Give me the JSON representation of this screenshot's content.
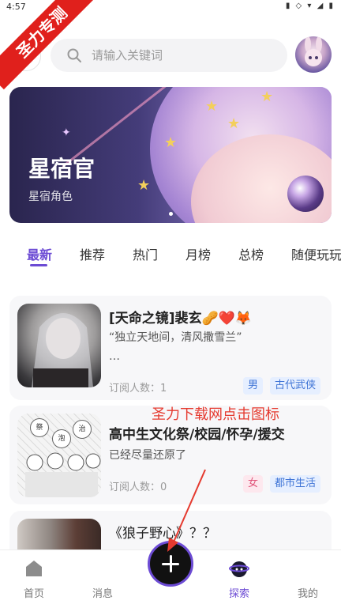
{
  "status_bar": {
    "time": "4:57",
    "system_icons": "▮ ◇ ▾ ◢ ▮"
  },
  "watermark": {
    "text": "圣力专测"
  },
  "search": {
    "placeholder": "请输入关键词"
  },
  "banner": {
    "title": "星宿官",
    "subtitle": "星宿角色"
  },
  "tabs": [
    {
      "label": "最新",
      "active": true
    },
    {
      "label": "推荐",
      "active": false
    },
    {
      "label": "热门",
      "active": false
    },
    {
      "label": "月榜",
      "active": false
    },
    {
      "label": "总榜",
      "active": false
    },
    {
      "label": "随便玩玩",
      "active": false
    }
  ],
  "cards": [
    {
      "name": "[天命之镜]裴玄🥜❤️🦊",
      "desc": "“独立天地间，清风撒雪兰”",
      "desc_more": "…",
      "subs": "订阅人数：1",
      "gender": "男",
      "genre": "古代武侠"
    },
    {
      "name": "高中生文化祭/校园/怀孕/援交",
      "desc": "已经尽量还原了",
      "subs": "订阅人数：0",
      "gender": "女",
      "genre": "都市生活"
    },
    {
      "name": "《狼子野心》？？"
    }
  ],
  "overlay_note": {
    "text": "圣力下载网点击图标"
  },
  "bottom_nav": {
    "home": "首页",
    "messages": "消息",
    "explore": "探索",
    "mine": "我的"
  },
  "colors": {
    "accent": "#6c4bd4",
    "annotation": "#e53a2f",
    "tag_blue": "#3f74d6",
    "tag_pink": "#e0557a"
  },
  "icons": [
    "menu-icon",
    "search-icon",
    "home-icon",
    "explore-icon",
    "plus-icon"
  ]
}
